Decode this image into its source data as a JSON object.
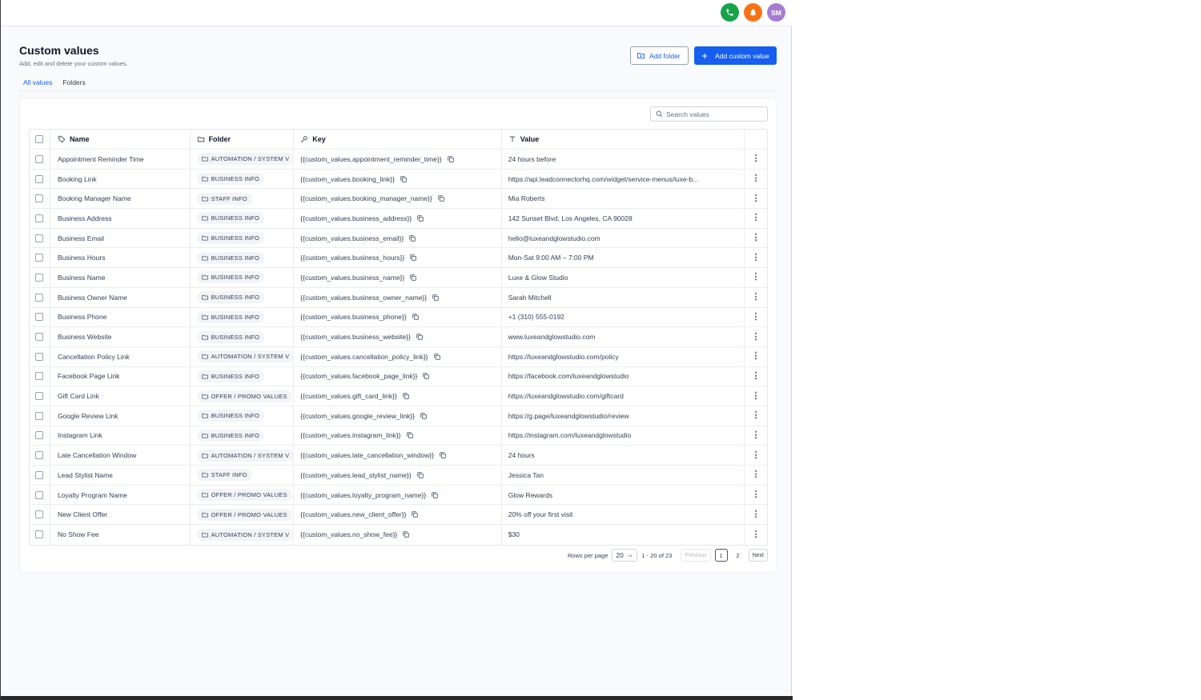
{
  "topbar": {
    "icons": [
      "phone-icon",
      "bell-icon"
    ],
    "avatar_initials": "SM",
    "colors": {
      "phone": "#16a34a",
      "bell": "#f97316",
      "avatar": "#a77bd1"
    }
  },
  "header": {
    "title": "Custom values",
    "subtitle": "Add, edit and delete your custom values.",
    "add_folder_label": "Add folder",
    "add_custom_value_label": "Add custom value"
  },
  "tabs": [
    {
      "label": "All values",
      "active": true
    },
    {
      "label": "Folders",
      "active": false
    }
  ],
  "search": {
    "placeholder": "Search values"
  },
  "table": {
    "columns": [
      "Name",
      "Folder",
      "Key",
      "Value"
    ],
    "rows": [
      {
        "name": "Appointment Reminder Time",
        "folder": "AUTOMATION / SYSTEM V",
        "key": "{{custom_values.appointment_reminder_time}}",
        "value": "24 hours before"
      },
      {
        "name": "Booking Link",
        "folder": "BUSINESS INFO",
        "key": "{{custom_values.booking_link}}",
        "value": "https://api.leadconnectorhq.com/widget/service-menus/luxe-b..."
      },
      {
        "name": "Booking Manager Name",
        "folder": "STAFF INFO",
        "key": "{{custom_values.booking_manager_name}}",
        "value": "Mia Roberts"
      },
      {
        "name": "Business Address",
        "folder": "BUSINESS INFO",
        "key": "{{custom_values.business_address}}",
        "value": "142 Sunset Blvd, Los Angeles, CA 90028"
      },
      {
        "name": "Business Email",
        "folder": "BUSINESS INFO",
        "key": "{{custom_values.business_email}}",
        "value": "hello@luxeandglowstudio.com"
      },
      {
        "name": "Business Hours",
        "folder": "BUSINESS INFO",
        "key": "{{custom_values.business_hours}}",
        "value": "Mon-Sat 9:00 AM – 7:00 PM"
      },
      {
        "name": "Business Name",
        "folder": "BUSINESS INFO",
        "key": "{{custom_values.business_name}}",
        "value": "Luxe & Glow Studio"
      },
      {
        "name": "Business Owner Name",
        "folder": "BUSINESS INFO",
        "key": "{{custom_values.business_owner_name}}",
        "value": "Sarah Mitchell"
      },
      {
        "name": "Business Phone",
        "folder": "BUSINESS INFO",
        "key": "{{custom_values.business_phone}}",
        "value": "+1 (310) 555-0192"
      },
      {
        "name": "Business Website",
        "folder": "BUSINESS INFO",
        "key": "{{custom_values.business_website}}",
        "value": "www.luxeandglowstudio.com"
      },
      {
        "name": "Cancellation Policy Link",
        "folder": "AUTOMATION / SYSTEM V",
        "key": "{{custom_values.cancellation_policy_link}}",
        "value": "https://luxeandglowstudio.com/policy"
      },
      {
        "name": "Facebook Page Link",
        "folder": "BUSINESS INFO",
        "key": "{{custom_values.facebook_page_link}}",
        "value": "https://facebook.com/luxeandglowstudio"
      },
      {
        "name": "Gift Card Link",
        "folder": "OFFER / PROMO VALUES",
        "key": "{{custom_values.gift_card_link}}",
        "value": "https://luxeandglowstudio.com/giftcard"
      },
      {
        "name": "Google Review Link",
        "folder": "BUSINESS INFO",
        "key": "{{custom_values.google_review_link}}",
        "value": "https://g.page/luxeandglowstudio/review"
      },
      {
        "name": "Instagram Link",
        "folder": "BUSINESS INFO",
        "key": "{{custom_values.instagram_link}}",
        "value": "https://instagram.com/luxeandglowstudio"
      },
      {
        "name": "Late Cancellation Window",
        "folder": "AUTOMATION / SYSTEM V",
        "key": "{{custom_values.late_cancellation_window}}",
        "value": "24 hours"
      },
      {
        "name": "Lead Stylist Name",
        "folder": "STAFF INFO",
        "key": "{{custom_values.lead_stylist_name}}",
        "value": "Jessica Tan"
      },
      {
        "name": "Loyalty Program Name",
        "folder": "OFFER / PROMO VALUES",
        "key": "{{custom_values.loyalty_program_name}}",
        "value": "Glow Rewards"
      },
      {
        "name": "New Client Offer",
        "folder": "OFFER / PROMO VALUES",
        "key": "{{custom_values.new_client_offer}}",
        "value": "20% off your first visit"
      },
      {
        "name": "No Show Fee",
        "folder": "AUTOMATION / SYSTEM V",
        "key": "{{custom_values.no_show_fee}}",
        "value": "$30"
      }
    ]
  },
  "pagination": {
    "rows_per_page_label": "Rows per page",
    "rows_per_page_value": "20",
    "range_text": "1 - 20 of 23",
    "previous_label": "Previous",
    "pages": [
      "1",
      "2"
    ],
    "current_page": "1",
    "next_label": "Next"
  },
  "colors": {
    "accent": "#155eef",
    "border": "#e4e7ec",
    "chip_bg": "#f2f4f7"
  }
}
